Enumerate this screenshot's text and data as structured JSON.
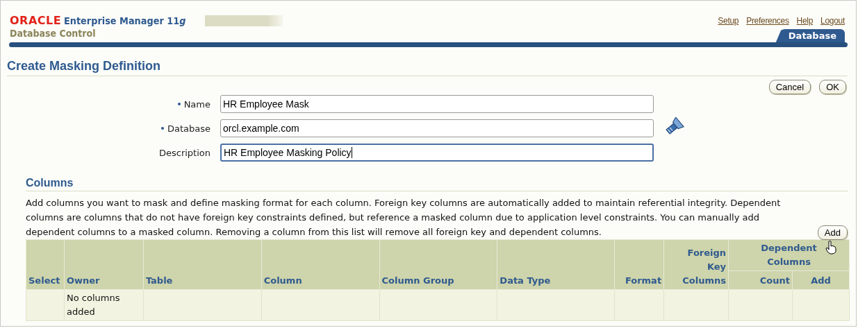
{
  "header": {
    "logo": "ORACLE",
    "product": "Enterprise Manager 11",
    "product_suffix": "g",
    "subtitle": "Database Control",
    "links": [
      "Setup",
      "Preferences",
      "Help",
      "Logout"
    ],
    "tabs": [
      {
        "label": "Database",
        "selected": true
      }
    ]
  },
  "page_title": "Create Masking Definition",
  "actions": [
    "Cancel",
    "OK"
  ],
  "fields": [
    {
      "label": "Name",
      "required": true,
      "value": "HR Employee Mask",
      "focused": false,
      "lookup": false
    },
    {
      "label": "Database",
      "required": true,
      "value": "orcl.example.com",
      "focused": false,
      "lookup": true
    },
    {
      "label": "Description",
      "required": false,
      "value": "HR Employee Masking Policy",
      "focused": true,
      "lookup": false
    }
  ],
  "columns_section": {
    "title": "Columns",
    "description": "Add columns you want to mask and define masking format for each column. Foreign key columns are automatically added to maintain referential integrity. Dependent columns are columns that do not have foreign key constraints defined, but reference a masked column due to application level constraints. You can manually add dependent columns to a masked column. Removing a column from this list will remove all foreign key and dependent columns.",
    "add_button": "Add",
    "table": {
      "columns": [
        "Select",
        "Owner",
        "Table",
        "Column",
        "Column Group",
        "Data Type",
        "Format",
        "Foreign Key Columns"
      ],
      "group_header": "Dependent Columns",
      "group_columns": [
        "Count",
        "Add"
      ],
      "empty_text": "No columns added"
    }
  }
}
